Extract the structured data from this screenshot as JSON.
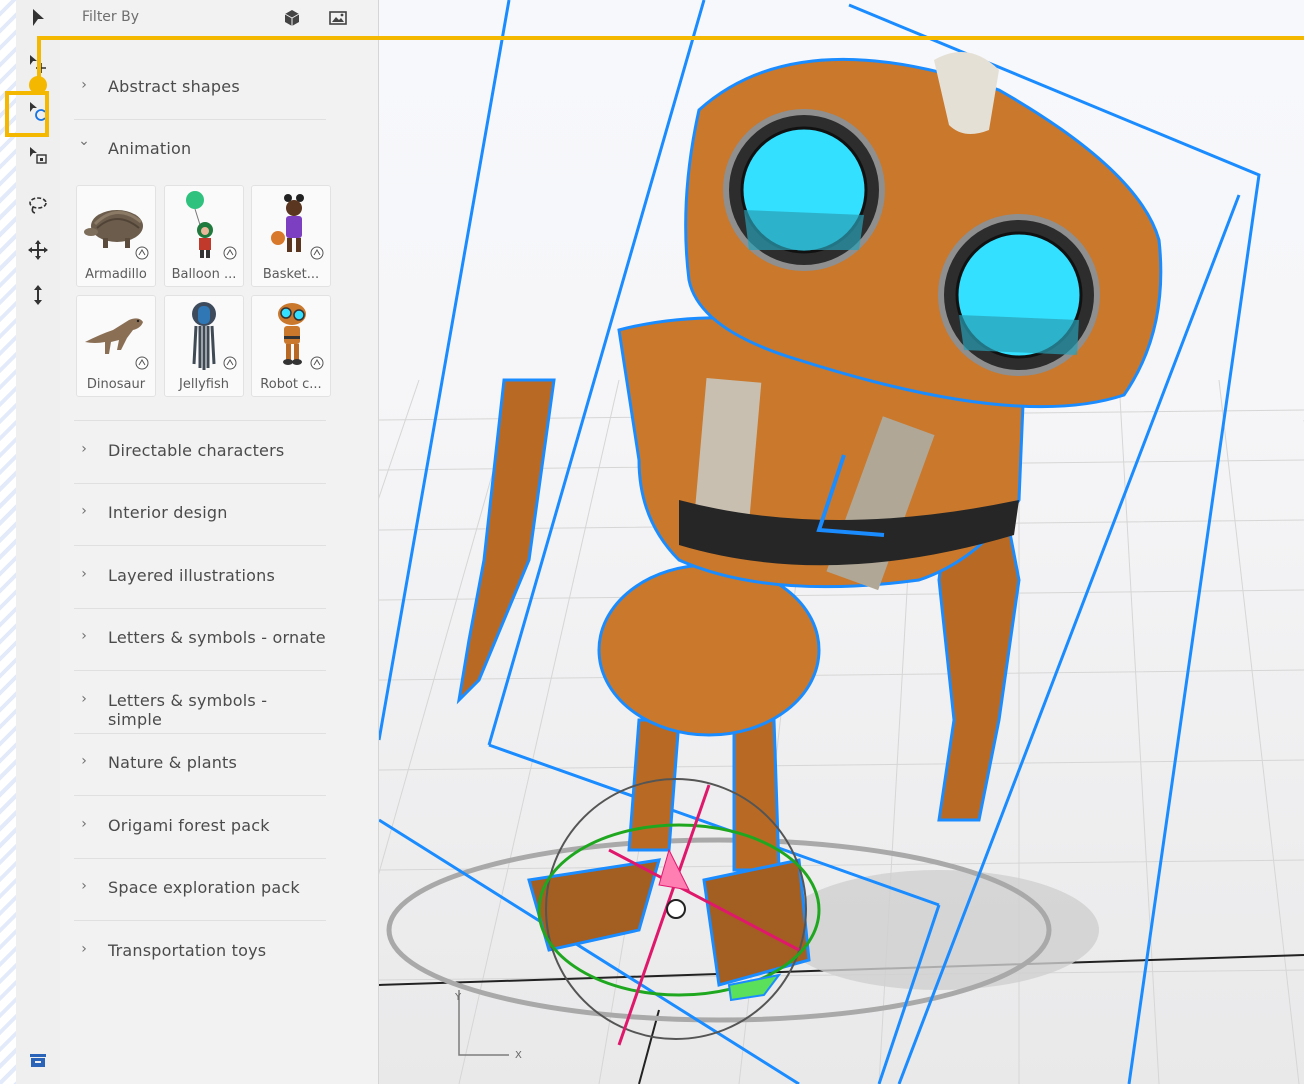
{
  "filter": {
    "label": "Filter By",
    "icons": [
      "cube-icon",
      "image-icon"
    ]
  },
  "toolbar": {
    "tools": [
      {
        "name": "select-tool",
        "icon": "arrow-pointer-icon"
      },
      {
        "name": "move-tool",
        "icon": "arrow-move-icon"
      },
      {
        "name": "rotate-tool",
        "icon": "arrow-rotate-icon",
        "active": true
      },
      {
        "name": "scale-tool",
        "icon": "arrow-scale-icon"
      },
      {
        "name": "magic-select-tool",
        "icon": "lasso-icon"
      },
      {
        "name": "orbit-pan-tool",
        "icon": "move-cross-icon"
      },
      {
        "name": "dolly-tool",
        "icon": "vertical-arrows-icon"
      },
      {
        "name": "library-toggle",
        "icon": "drawer-icon"
      }
    ]
  },
  "categories": [
    {
      "label": "Abstract shapes",
      "expanded": false
    },
    {
      "label": "Animation",
      "expanded": true
    },
    {
      "label": "Directable characters",
      "expanded": false
    },
    {
      "label": "Interior design",
      "expanded": false
    },
    {
      "label": "Layered illustrations",
      "expanded": false
    },
    {
      "label": "Letters & symbols - ornate",
      "expanded": false
    },
    {
      "label": "Letters & symbols - simple",
      "expanded": false
    },
    {
      "label": "Nature & plants",
      "expanded": false
    },
    {
      "label": "Origami forest pack",
      "expanded": false
    },
    {
      "label": "Space exploration pack",
      "expanded": false
    },
    {
      "label": "Transportation toys",
      "expanded": false
    }
  ],
  "chevrons": {
    "collapsed": "›",
    "expanded": "⌄"
  },
  "assets": [
    {
      "name": "Armadillo"
    },
    {
      "name": "Balloon ..."
    },
    {
      "name": "Basket..."
    },
    {
      "name": "Dinosaur"
    },
    {
      "name": "Jellyfish"
    },
    {
      "name": "Robot c..."
    }
  ],
  "viewport": {
    "axis_labels": {
      "y": "Y",
      "x": "X"
    },
    "colors": {
      "selection": "#1a8cff",
      "callout": "#f5b800",
      "robot": "#c9782c",
      "eyes": "#33e0ff"
    }
  }
}
